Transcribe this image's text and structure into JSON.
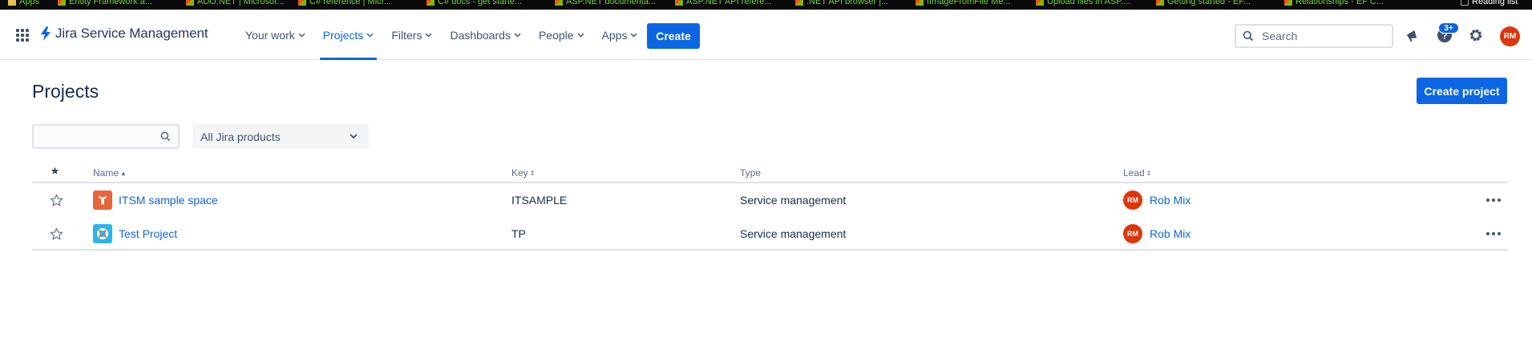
{
  "bookmarks": [
    {
      "label": "Apps",
      "icon": "apps-grid-icon"
    },
    {
      "label": "Entity Framework a...",
      "icon": "microsoft-icon"
    },
    {
      "label": "ADO.NET | Microsof...",
      "icon": "microsoft-icon"
    },
    {
      "label": "C# reference | Micr...",
      "icon": "microsoft-icon"
    },
    {
      "label": "C# docs - get starte...",
      "icon": "microsoft-icon"
    },
    {
      "label": "ASP.NET documenta...",
      "icon": "microsoft-icon"
    },
    {
      "label": "ASP.NET API refere...",
      "icon": "microsoft-icon"
    },
    {
      "label": ".NET API browser |...",
      "icon": "microsoft-icon"
    },
    {
      "label": "IImageFromFile Me...",
      "icon": "microsoft-icon"
    },
    {
      "label": "Upload files in ASP....",
      "icon": "microsoft-icon"
    },
    {
      "label": "Getting started - EF...",
      "icon": "microsoft-icon"
    },
    {
      "label": "Relationships - EF C...",
      "icon": "microsoft-icon"
    },
    {
      "label": "Reading list",
      "icon": "reading-list-icon"
    }
  ],
  "header": {
    "product_name": "Jira Service Management",
    "nav": [
      {
        "label": "Your work",
        "active": false
      },
      {
        "label": "Projects",
        "active": true
      },
      {
        "label": "Filters",
        "active": false
      },
      {
        "label": "Dashboards",
        "active": false
      },
      {
        "label": "People",
        "active": false
      },
      {
        "label": "Apps",
        "active": false
      }
    ],
    "create_label": "Create",
    "search_placeholder": "Search",
    "notification_badge": "3+",
    "user_initials": "RM"
  },
  "page": {
    "title": "Projects",
    "create_project_label": "Create project",
    "filter_placeholder": "",
    "product_filter": "All Jira products"
  },
  "table": {
    "columns": {
      "name": "Name",
      "key": "Key",
      "type": "Type",
      "lead": "Lead"
    },
    "rows": [
      {
        "name": "ITSM sample space",
        "key": "ITSAMPLE",
        "type": "Service management",
        "lead": "Rob Mix",
        "lead_initials": "RM",
        "icon": "wrench-icon"
      },
      {
        "name": "Test Project",
        "key": "TP",
        "type": "Service management",
        "lead": "Rob Mix",
        "lead_initials": "RM",
        "icon": "lifebuoy-icon"
      }
    ]
  },
  "colors": {
    "primary": "#0c66e4",
    "avatar": "#de350b",
    "text": "#172b4d",
    "muted": "#5e6c84",
    "border": "#dfe1e6"
  }
}
